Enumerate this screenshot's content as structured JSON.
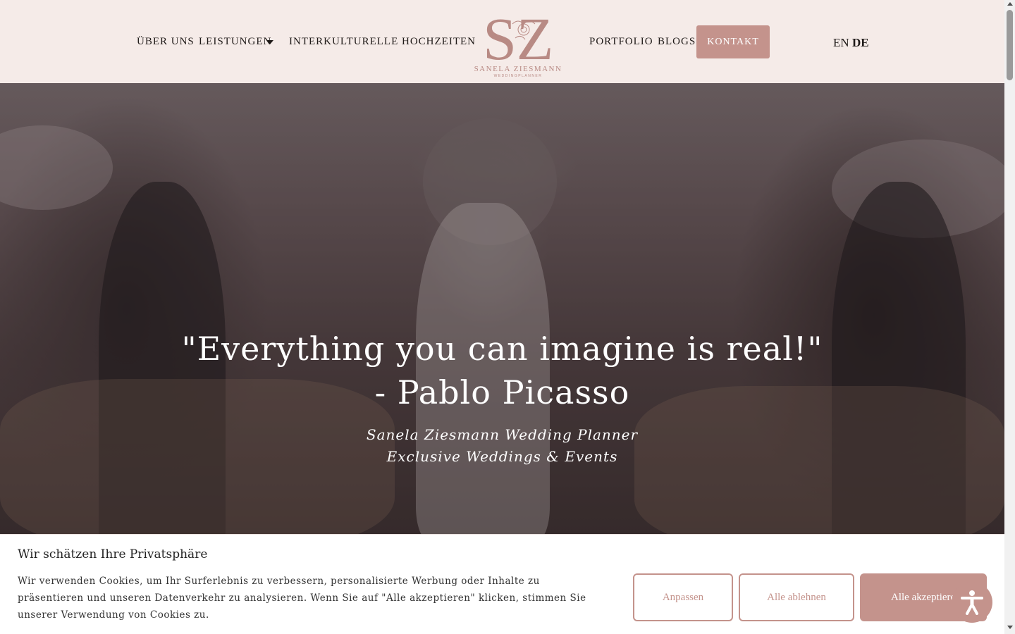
{
  "header": {
    "nav_left": [
      "ÜBER UNS",
      "LEISTUNGEN",
      "INTERKULTURELLE HOCHZEITEN"
    ],
    "nav_right": [
      "PORTFOLIO",
      "BLOGS"
    ],
    "cta": "KONTAKT",
    "languages": [
      "EN",
      "DE"
    ],
    "active_language": "DE",
    "logo": {
      "monogram": "SZ",
      "name": "SANELA ZIESMANN",
      "tagline": "WEDDINGPLANNER"
    }
  },
  "hero": {
    "quote_line1": "\"Everything you can imagine is real!\"",
    "quote_line2": "- Pablo Picasso",
    "subtitle_line1": "Sanela Ziesmann Wedding Planner",
    "subtitle_line2": "Exclusive Weddings & Events"
  },
  "cookie_banner": {
    "title": "Wir schätzen Ihre Privatsphäre",
    "text": "Wir verwenden Cookies, um Ihr Surferlebnis zu verbessern, personalisierte Werbung oder Inhalte zu präsentieren und unseren Datenverkehr zu analysieren. Wenn Sie auf \"Alle akzeptieren\" klicken, stimmen Sie unserer Verwendung von Cookies zu.",
    "buttons": [
      "Anpassen",
      "Alle ablehnen",
      "Alle akzeptieren"
    ]
  },
  "icons": [
    "chevron-down-icon",
    "accessibility-icon",
    "logo-flower-icon"
  ],
  "colors": {
    "accent": "#c4938c",
    "header_bg": "#f5ebe8",
    "text_dark": "#1f1a18"
  }
}
